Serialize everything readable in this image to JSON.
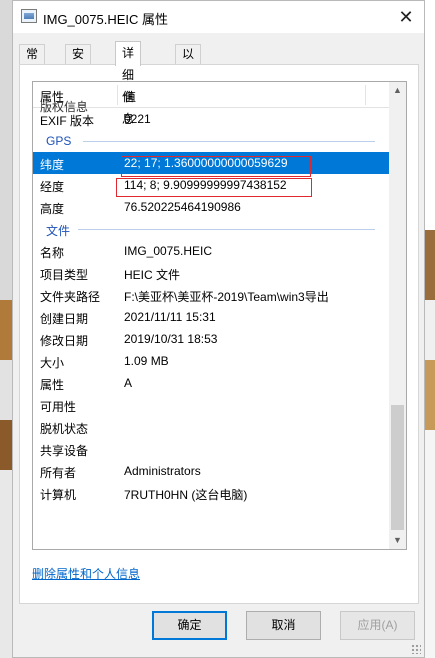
{
  "window": {
    "title": "IMG_0075.HEIC 属性",
    "close_glyph": "✕"
  },
  "tabs": [
    "常规",
    "安全",
    "详细信息",
    "以前的版本"
  ],
  "active_tab_index": 2,
  "list": {
    "headers": {
      "name": "属性",
      "value": "值"
    },
    "clipped_row": "版权信息",
    "rows_before_gps": [
      {
        "name": "EXIF 版本",
        "value": "0221"
      }
    ],
    "gps_group": "GPS",
    "gps_rows": [
      {
        "name": "纬度",
        "value": "22; 17; 1.36000000000059629",
        "selected": true
      },
      {
        "name": "经度",
        "value": "114; 8; 9.90999999997438152"
      },
      {
        "name": "高度",
        "value": "76.520225464190986"
      }
    ],
    "file_group": "文件",
    "file_rows": [
      {
        "name": "名称",
        "value": "IMG_0075.HEIC"
      },
      {
        "name": "项目类型",
        "value": "HEIC 文件"
      },
      {
        "name": "文件夹路径",
        "value": "F:\\美亚杯\\美亚杯-2019\\Team\\win3导出"
      },
      {
        "name": "创建日期",
        "value": "2021/11/11 15:31"
      },
      {
        "name": "修改日期",
        "value": "2019/10/31 18:53"
      },
      {
        "name": "大小",
        "value": "1.09 MB"
      },
      {
        "name": "属性",
        "value": "A"
      },
      {
        "name": "可用性",
        "value": ""
      },
      {
        "name": "脱机状态",
        "value": ""
      },
      {
        "name": "共享设备",
        "value": ""
      },
      {
        "name": "所有者",
        "value": "Administrators"
      },
      {
        "name": "计算机",
        "value": "7RUTH0HN (这台电脑)"
      }
    ]
  },
  "remove_link": "删除属性和个人信息",
  "buttons": {
    "ok": "确定",
    "cancel": "取消",
    "apply": "应用(A)"
  },
  "colors": {
    "selection": "#0078d7",
    "group_header": "#1e52b7",
    "link": "#0066cc",
    "highlight_box": "#e0282e"
  }
}
